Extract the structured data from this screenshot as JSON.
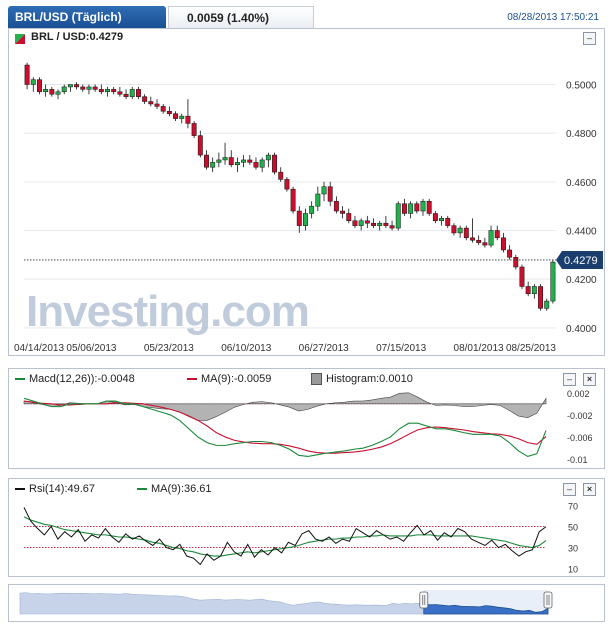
{
  "header": {
    "pair_tab": "BRL/USD (Täglich)",
    "change": "0.0059 (1.40%)",
    "timestamp": "08/28/2013 17:50:21"
  },
  "main_chart": {
    "title": "BRL / USD:0.4279",
    "last_price_label": "0.4279",
    "watermark": "Investing.com"
  },
  "macd_panel": {
    "macd_label": "Macd(12,26)):-0.0048",
    "ma_label": "MA(9):-0.0059",
    "hist_label": "Histogram:0.0010",
    "close_button": "×"
  },
  "rsi_panel": {
    "rsi_label": "Rsi(14):49.67",
    "ma_label": "MA(9):36.61",
    "close_button": "×"
  },
  "colors": {
    "up": "#22b14c",
    "down": "#c8102e",
    "accent": "#1a4f93",
    "macd": "#1a8a3a",
    "signal": "#c8102e",
    "histogram": "#9a9a9a"
  },
  "chart_data": [
    {
      "type": "candlestick",
      "ylim": [
        0.395,
        0.515
      ],
      "yticks": [
        "0.5000",
        "0.4800",
        "0.4600",
        "0.4400",
        "0.4200",
        "0.4000"
      ],
      "xticks": [
        "04/14/2013",
        "05/06/2013",
        "05/23/2013",
        "06/10/2013",
        "06/27/2013",
        "07/15/2013",
        "08/01/2013",
        "08/25/2013"
      ],
      "last_price": 0.4279,
      "candles": [
        [
          0.508,
          0.509,
          0.498,
          0.5
        ],
        [
          0.5,
          0.503,
          0.497,
          0.502
        ],
        [
          0.502,
          0.503,
          0.496,
          0.497
        ],
        [
          0.497,
          0.5,
          0.495,
          0.498
        ],
        [
          0.498,
          0.499,
          0.495,
          0.496
        ],
        [
          0.496,
          0.498,
          0.494,
          0.497
        ],
        [
          0.497,
          0.5,
          0.496,
          0.499
        ],
        [
          0.499,
          0.5,
          0.497,
          0.5
        ],
        [
          0.5,
          0.501,
          0.498,
          0.499
        ],
        [
          0.499,
          0.5,
          0.497,
          0.498
        ],
        [
          0.498,
          0.5,
          0.496,
          0.499
        ],
        [
          0.499,
          0.5,
          0.497,
          0.498
        ],
        [
          0.498,
          0.5,
          0.496,
          0.497
        ],
        [
          0.497,
          0.499,
          0.495,
          0.498
        ],
        [
          0.498,
          0.499,
          0.496,
          0.497
        ],
        [
          0.497,
          0.499,
          0.495,
          0.496
        ],
        [
          0.496,
          0.498,
          0.494,
          0.495
        ],
        [
          0.495,
          0.499,
          0.494,
          0.498
        ],
        [
          0.498,
          0.499,
          0.494,
          0.495
        ],
        [
          0.495,
          0.496,
          0.492,
          0.493
        ],
        [
          0.493,
          0.495,
          0.491,
          0.492
        ],
        [
          0.492,
          0.494,
          0.49,
          0.491
        ],
        [
          0.491,
          0.492,
          0.488,
          0.489
        ],
        [
          0.489,
          0.491,
          0.487,
          0.488
        ],
        [
          0.488,
          0.489,
          0.485,
          0.486
        ],
        [
          0.486,
          0.488,
          0.484,
          0.487
        ],
        [
          0.487,
          0.494,
          0.482,
          0.484
        ],
        [
          0.484,
          0.485,
          0.478,
          0.479
        ],
        [
          0.479,
          0.481,
          0.47,
          0.471
        ],
        [
          0.471,
          0.473,
          0.465,
          0.466
        ],
        [
          0.466,
          0.47,
          0.464,
          0.468
        ],
        [
          0.468,
          0.472,
          0.466,
          0.469
        ],
        [
          0.469,
          0.476,
          0.467,
          0.47
        ],
        [
          0.47,
          0.473,
          0.466,
          0.467
        ],
        [
          0.467,
          0.47,
          0.464,
          0.468
        ],
        [
          0.468,
          0.471,
          0.466,
          0.469
        ],
        [
          0.469,
          0.471,
          0.467,
          0.468
        ],
        [
          0.468,
          0.47,
          0.465,
          0.466
        ],
        [
          0.466,
          0.47,
          0.464,
          0.469
        ],
        [
          0.469,
          0.472,
          0.466,
          0.471
        ],
        [
          0.471,
          0.472,
          0.463,
          0.464
        ],
        [
          0.464,
          0.466,
          0.46,
          0.461
        ],
        [
          0.461,
          0.462,
          0.456,
          0.457
        ],
        [
          0.457,
          0.458,
          0.447,
          0.448
        ],
        [
          0.448,
          0.45,
          0.439,
          0.442
        ],
        [
          0.442,
          0.449,
          0.44,
          0.447
        ],
        [
          0.447,
          0.452,
          0.445,
          0.45
        ],
        [
          0.45,
          0.458,
          0.448,
          0.455
        ],
        [
          0.455,
          0.46,
          0.452,
          0.458
        ],
        [
          0.458,
          0.46,
          0.45,
          0.452
        ],
        [
          0.452,
          0.454,
          0.447,
          0.448
        ],
        [
          0.448,
          0.45,
          0.445,
          0.447
        ],
        [
          0.447,
          0.449,
          0.443,
          0.444
        ],
        [
          0.444,
          0.446,
          0.441,
          0.442
        ],
        [
          0.442,
          0.445,
          0.44,
          0.444
        ],
        [
          0.444,
          0.446,
          0.441,
          0.443
        ],
        [
          0.443,
          0.445,
          0.441,
          0.442
        ],
        [
          0.442,
          0.444,
          0.44,
          0.443
        ],
        [
          0.443,
          0.446,
          0.441,
          0.442
        ],
        [
          0.442,
          0.444,
          0.44,
          0.441
        ],
        [
          0.441,
          0.452,
          0.44,
          0.451
        ],
        [
          0.451,
          0.453,
          0.446,
          0.447
        ],
        [
          0.447,
          0.452,
          0.445,
          0.451
        ],
        [
          0.451,
          0.452,
          0.447,
          0.448
        ],
        [
          0.448,
          0.453,
          0.446,
          0.452
        ],
        [
          0.452,
          0.453,
          0.446,
          0.447
        ],
        [
          0.447,
          0.448,
          0.443,
          0.444
        ],
        [
          0.444,
          0.446,
          0.442,
          0.445
        ],
        [
          0.445,
          0.446,
          0.441,
          0.442
        ],
        [
          0.442,
          0.443,
          0.438,
          0.439
        ],
        [
          0.439,
          0.442,
          0.437,
          0.441
        ],
        [
          0.441,
          0.442,
          0.436,
          0.437
        ],
        [
          0.437,
          0.445,
          0.435,
          0.436
        ],
        [
          0.436,
          0.438,
          0.434,
          0.435
        ],
        [
          0.435,
          0.437,
          0.433,
          0.434
        ],
        [
          0.434,
          0.442,
          0.433,
          0.44
        ],
        [
          0.44,
          0.442,
          0.436,
          0.437
        ],
        [
          0.437,
          0.439,
          0.431,
          0.432
        ],
        [
          0.432,
          0.434,
          0.428,
          0.429
        ],
        [
          0.429,
          0.43,
          0.424,
          0.425
        ],
        [
          0.425,
          0.426,
          0.416,
          0.417
        ],
        [
          0.417,
          0.419,
          0.413,
          0.414
        ],
        [
          0.414,
          0.418,
          0.412,
          0.417
        ],
        [
          0.417,
          0.418,
          0.407,
          0.408
        ],
        [
          0.408,
          0.412,
          0.407,
          0.411
        ],
        [
          0.411,
          0.428,
          0.41,
          0.427
        ]
      ]
    },
    {
      "type": "line",
      "title": "Macd(12,26))",
      "ylim": [
        -0.0105,
        0.0025
      ],
      "yticks": [
        "0.002",
        "-0.002",
        "-0.006",
        "-0.01"
      ],
      "reference_line": 0,
      "series": [
        {
          "name": "Macd(12,26))",
          "values": [
            0.001,
            0.0005,
            0,
            -0.0005,
            -0.0005,
            0,
            0,
            0,
            0,
            0.0005,
            0.0005,
            0,
            0,
            -0.0005,
            -0.001,
            -0.0015,
            -0.002,
            -0.003,
            -0.0045,
            -0.006,
            -0.007,
            -0.0075,
            -0.0075,
            -0.0072,
            -0.007,
            -0.0068,
            -0.0068,
            -0.007,
            -0.0075,
            -0.0082,
            -0.0093,
            -0.0095,
            -0.0092,
            -0.0089,
            -0.0087,
            -0.0085,
            -0.0082,
            -0.008,
            -0.0075,
            -0.0068,
            -0.006,
            -0.0045,
            -0.0035,
            -0.0035,
            -0.004,
            -0.0045,
            -0.0045,
            -0.0048,
            -0.0052,
            -0.0055,
            -0.0055,
            -0.0055,
            -0.0058,
            -0.007,
            -0.0085,
            -0.0095,
            -0.009,
            -0.0048
          ]
        },
        {
          "name": "MA(9)",
          "values": [
            0.0005,
            0.0003,
            0.0001,
            0,
            -0.0002,
            -0.0002,
            -0.0001,
            0,
            0,
            0,
            0.0002,
            0.0002,
            0.0001,
            0,
            -0.0003,
            -0.0006,
            -0.001,
            -0.0015,
            -0.0022,
            -0.003,
            -0.004,
            -0.0052,
            -0.006,
            -0.0066,
            -0.0069,
            -0.0071,
            -0.0072,
            -0.0072,
            -0.0073,
            -0.0076,
            -0.008,
            -0.0085,
            -0.0088,
            -0.0089,
            -0.0089,
            -0.0088,
            -0.0087,
            -0.0085,
            -0.0082,
            -0.0078,
            -0.0072,
            -0.0064,
            -0.0055,
            -0.0047,
            -0.0043,
            -0.0042,
            -0.0043,
            -0.0045,
            -0.0047,
            -0.005,
            -0.0052,
            -0.0054,
            -0.0055,
            -0.0058,
            -0.0063,
            -0.007,
            -0.0073,
            -0.0059
          ]
        },
        {
          "name": "Histogram",
          "values": [
            0.0005,
            0.0002,
            -0.0001,
            -0.0005,
            -0.0003,
            0.0002,
            0.0001,
            0,
            0,
            0.0005,
            0.0003,
            -0.0002,
            -0.0001,
            -0.0005,
            -0.0007,
            -0.0009,
            -0.001,
            -0.0015,
            -0.0023,
            -0.003,
            -0.003,
            -0.0023,
            -0.0015,
            -0.0006,
            -0.0001,
            0.0003,
            0.0004,
            0.0002,
            -0.0002,
            -0.0006,
            -0.0013,
            -0.001,
            -0.0004,
            0,
            0.0002,
            0.0003,
            0.0005,
            0.0005,
            0.0007,
            0.001,
            0.0012,
            0.0019,
            0.002,
            0.0012,
            0.0003,
            -0.0003,
            -0.0002,
            -0.0003,
            -0.0005,
            -0.0005,
            -0.0003,
            -0.0001,
            -0.0003,
            -0.0012,
            -0.0022,
            -0.0025,
            -0.0017,
            0.001
          ]
        }
      ]
    },
    {
      "type": "line",
      "title": "Rsi(14)",
      "ylim": [
        5,
        75
      ],
      "yticks": [
        "70",
        "50",
        "30",
        "10"
      ],
      "reference_lines": [
        50,
        30
      ],
      "series": [
        {
          "name": "Rsi(14)",
          "values": [
            68,
            55,
            48,
            42,
            50,
            38,
            45,
            40,
            47,
            36,
            42,
            39,
            48,
            40,
            35,
            43,
            38,
            41,
            36,
            32,
            38,
            30,
            28,
            33,
            22,
            20,
            14,
            24,
            18,
            22,
            35,
            26,
            22,
            33,
            21,
            28,
            23,
            30,
            25,
            35,
            32,
            43,
            46,
            38,
            36,
            40,
            34,
            38,
            36,
            48,
            44,
            40,
            46,
            42,
            38,
            40,
            36,
            44,
            51,
            42,
            46,
            37,
            44,
            40,
            48,
            45,
            38,
            35,
            32,
            37,
            30,
            33,
            27,
            22,
            26,
            28,
            45,
            49.67
          ]
        },
        {
          "name": "MA(9)",
          "values": [
            59,
            56,
            54,
            52,
            51,
            49,
            47,
            46,
            45,
            44,
            43,
            42,
            42,
            41,
            40,
            40,
            39,
            38,
            37,
            35,
            34,
            32,
            30,
            29,
            27,
            26,
            24,
            23,
            22,
            22,
            23,
            24,
            25,
            26,
            25,
            26,
            27,
            28,
            29,
            30,
            31,
            33,
            35,
            36,
            37,
            38,
            38,
            39,
            39,
            40,
            40,
            41,
            41,
            42,
            41,
            41,
            41,
            41,
            42,
            42,
            42,
            41,
            41,
            41,
            41,
            41,
            41,
            40,
            39,
            38,
            37,
            36,
            34,
            32,
            31,
            30,
            32,
            36.61
          ]
        }
      ]
    }
  ]
}
